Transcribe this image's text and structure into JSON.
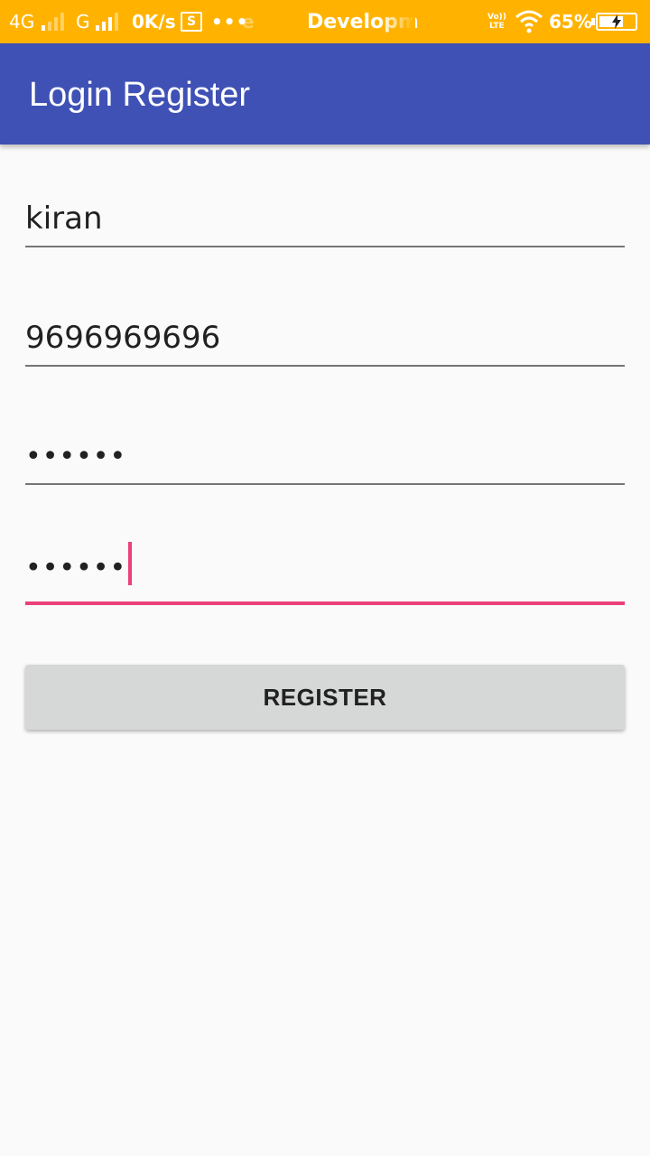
{
  "status_bar": {
    "network1": "4G",
    "network2": "G",
    "speed": "0K/s",
    "s_icon_label": "S",
    "more": "•••",
    "faded": "e",
    "title": "Developm",
    "volte_line1": "Vo))",
    "volte_line2": "LTE",
    "battery_pct": "65%",
    "color": "#ffb300"
  },
  "app_bar": {
    "title": "Login Register",
    "color": "#3f51b5"
  },
  "form": {
    "name_value": "kiran",
    "phone_value": "9696969696",
    "password_value": "••••••",
    "confirm_password_value": "••••••",
    "accent_color": "#ec407a"
  },
  "register_button": {
    "label": "REGISTER"
  }
}
